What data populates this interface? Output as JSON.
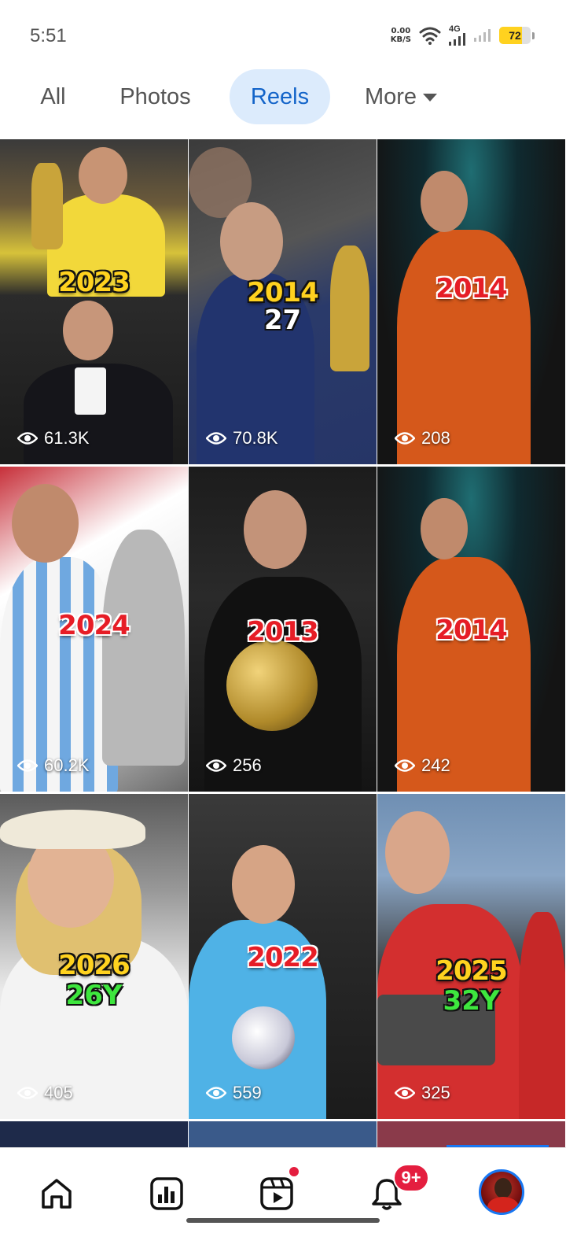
{
  "status_bar": {
    "time": "5:51",
    "net_speed_value": "0.00",
    "net_speed_unit": "KB/S",
    "network_type": "4G",
    "battery": "72"
  },
  "tabs": [
    {
      "label": "All",
      "active": false
    },
    {
      "label": "Photos",
      "active": false
    },
    {
      "label": "Reels",
      "active": true
    },
    {
      "label": "More",
      "active": false
    }
  ],
  "reels": [
    {
      "year": "2023",
      "views": "61.3K",
      "year_color": "yellow"
    },
    {
      "year": "2014",
      "extra": "27",
      "views": "70.8K",
      "year_color": "yellow"
    },
    {
      "year": "2014",
      "views": "208",
      "year_color": "red"
    },
    {
      "year": "2024",
      "views": "60.2K",
      "year_color": "red"
    },
    {
      "year": "2013",
      "views": "256",
      "year_color": "red"
    },
    {
      "year": "2014",
      "views": "242",
      "year_color": "red"
    },
    {
      "year": "2026",
      "extra": "26Y",
      "views": "405",
      "year_color": "yellow"
    },
    {
      "year": "2022",
      "views": "559",
      "year_color": "red"
    },
    {
      "year": "2025",
      "extra": "32Y",
      "views": "325",
      "year_color": "yellow"
    }
  ],
  "bottom_nav": {
    "notifications_badge": "9+",
    "items": [
      "home-icon",
      "insights-icon",
      "reels-icon",
      "notifications-icon",
      "profile-avatar"
    ]
  },
  "colors": {
    "accent": "#1364c9",
    "active_tab_bg": "#dcebfc",
    "badge": "#e41e3f",
    "year_yellow": "#ffd21f",
    "year_red": "#e61d26"
  }
}
